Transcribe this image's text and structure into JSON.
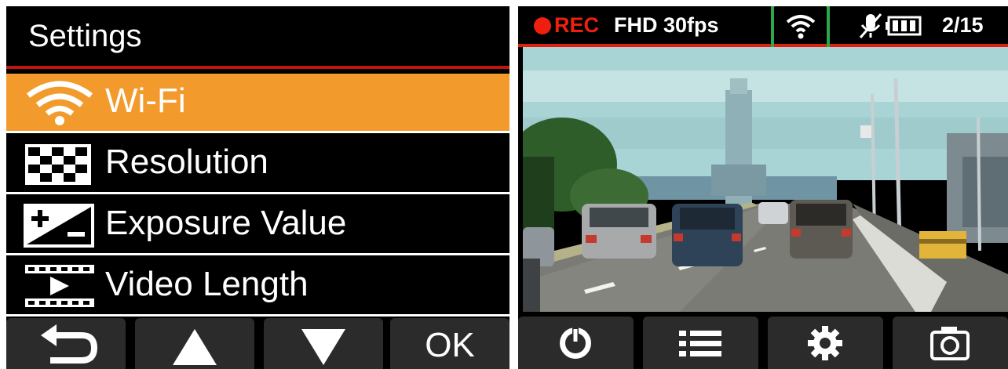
{
  "settings_screen": {
    "title": "Settings",
    "menu_items": [
      {
        "label": "Wi-Fi",
        "icon": "wifi-icon",
        "selected": true
      },
      {
        "label": "Resolution",
        "icon": "resolution-checker-icon",
        "selected": false
      },
      {
        "label": "Exposure Value",
        "icon": "exposure-value-icon",
        "selected": false
      },
      {
        "label": "Video Length",
        "icon": "video-length-icon",
        "selected": false
      }
    ],
    "bottom_buttons": [
      {
        "icon": "back-arrow-icon"
      },
      {
        "icon": "up-arrow-icon"
      },
      {
        "icon": "down-arrow-icon"
      },
      {
        "label": "OK"
      }
    ]
  },
  "live_view": {
    "rec_label": "REC",
    "mode_label": "FHD 30fps",
    "wifi_icon": "wifi-icon",
    "status_icons": [
      "mic-off-icon",
      "battery-icon"
    ],
    "counter": "2/15",
    "bottom_buttons": [
      {
        "icon": "power-icon"
      },
      {
        "icon": "menu-list-icon"
      },
      {
        "icon": "settings-gear-icon"
      },
      {
        "icon": "camera-icon"
      }
    ]
  },
  "colors": {
    "selected_item": "#f39a2c",
    "rec_red": "#ee1f0f",
    "highlight_green": "#2aa84a",
    "button_gray": "#2b2b2b"
  }
}
